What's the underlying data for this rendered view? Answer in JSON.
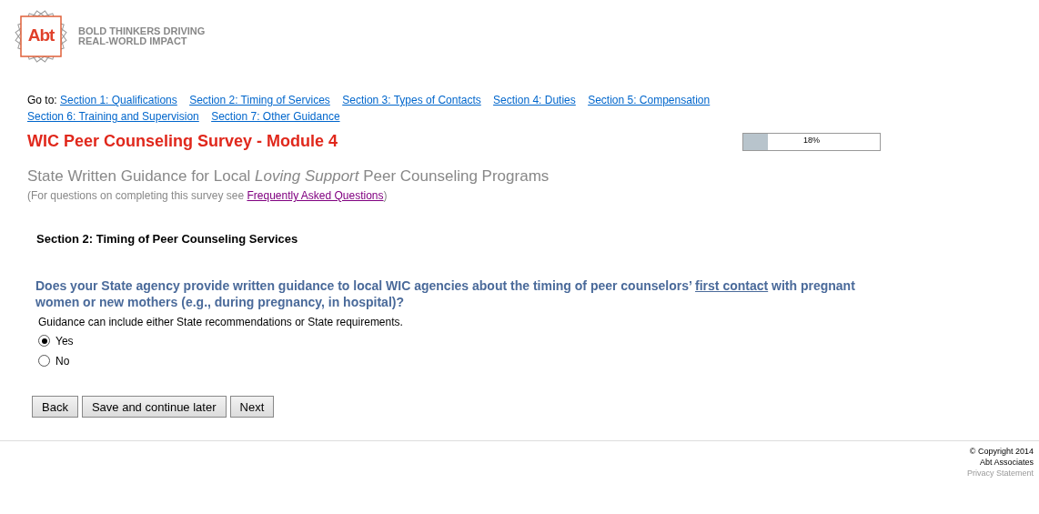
{
  "logo": {
    "mark": "Abt",
    "tagline": [
      "BOLD THINKERS DRIVING",
      "REAL-WORLD IMPACT"
    ]
  },
  "nav": {
    "label": "Go to:",
    "links": [
      "Section 1: Qualifications",
      "Section 2: Timing of Services",
      "Section 3: Types of Contacts",
      "Section 4: Duties",
      "Section 5: Compensation",
      "Section 6: Training and Supervision",
      "Section 7: Other Guidance"
    ]
  },
  "title": "WIC Peer Counseling Survey - Module 4",
  "progress": {
    "level": 0.18,
    "reading": "18%"
  },
  "subtitle": "State Written Guidance for Local *Loving Support* Peer Counseling Programs",
  "help": {
    "before": "(For questions on completing this survey see ",
    "link": "Frequently Asked Questions",
    "after": ")"
  },
  "section_heading": "Section 2: Timing of Peer Counseling Services",
  "question": {
    "before": "Does your State agency provide written guidance to local WIC agencies about the timing of peer counselors’ ",
    "underlined": "first contact",
    "after": " with pregnant women or new mothers (e.g., during pregnancy, in hospital)?"
  },
  "hint": "Guidance can include either State recommendations or State requirements.",
  "options": [
    {
      "label": "Yes",
      "selected": true
    },
    {
      "label": "No",
      "selected": false
    }
  ],
  "buttons": [
    "Back",
    "Save and continue later",
    "Next"
  ],
  "footer": {
    "copyright": "© Copyright 2014",
    "company": "Abt Associates",
    "privacy": "Privacy Statement"
  }
}
